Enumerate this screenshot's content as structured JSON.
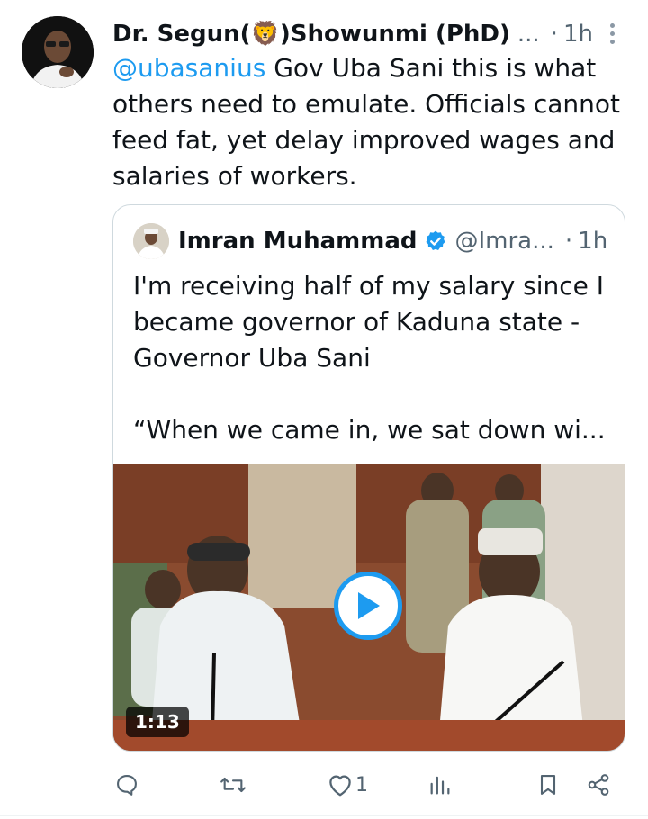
{
  "tweet": {
    "author_name": "Dr. Segun(🦁)Showunmi (PhD)",
    "author_ellipsis": "...",
    "dot": "·",
    "time": "1h",
    "mention": "@ubasanius",
    "text": " Gov Uba Sani this is what others need to emulate. Officials cannot feed fat, yet delay improved wages and salaries of workers."
  },
  "quote": {
    "author_name": "Imran Muhammad",
    "handle": "@Imra...",
    "dot": "·",
    "time": "1h",
    "text_line1": "I'm receiving half of my salary since I became governor of Kaduna state - Governor Uba Sani",
    "text_line2": "“When we came in, we sat down wi...",
    "video_duration": "1:13"
  },
  "actions": {
    "reply_count": "",
    "repost_count": "",
    "like_count": "1",
    "views_count": ""
  },
  "colors": {
    "accent": "#1d9bf0",
    "secondary_text": "#536471"
  }
}
